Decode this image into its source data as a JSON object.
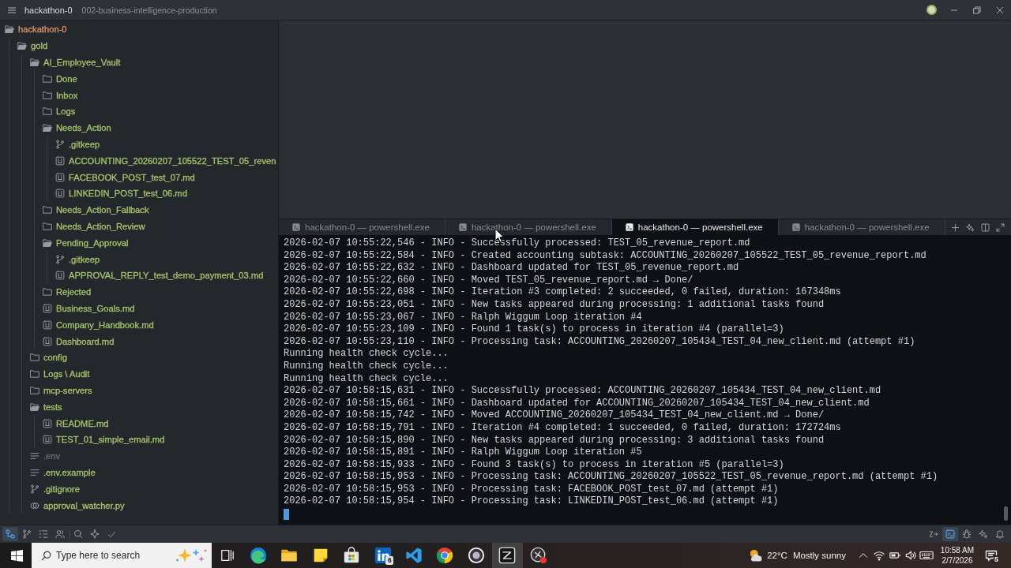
{
  "title_bar": {
    "project": "hackathon-0",
    "branch": "002-business-intelligence-production"
  },
  "sidebar": {
    "tree": [
      {
        "name": "hackathon-0",
        "kind": "folder",
        "expanded": true,
        "color": "#d9966b",
        "children": [
          {
            "name": "gold",
            "kind": "folder",
            "expanded": true,
            "color": "#a6c46d",
            "children": [
              {
                "name": "AI_Employee_Vault",
                "kind": "folder",
                "expanded": true,
                "color": "#a6c46d",
                "children": [
                  {
                    "name": "Done",
                    "kind": "folder",
                    "expanded": false,
                    "color": "#a6c46d"
                  },
                  {
                    "name": "Inbox",
                    "kind": "folder",
                    "expanded": false,
                    "color": "#a6c46d"
                  },
                  {
                    "name": "Logs",
                    "kind": "folder",
                    "expanded": false,
                    "color": "#a6c46d"
                  },
                  {
                    "name": "Needs_Action",
                    "kind": "folder",
                    "expanded": true,
                    "color": "#a6c46d",
                    "children": [
                      {
                        "name": ".gitkeep",
                        "kind": "git",
                        "color": "#a6c46d"
                      },
                      {
                        "name": "ACCOUNTING_20260207_105522_TEST_05_reven",
                        "kind": "markdown",
                        "color": "#a6c46d"
                      },
                      {
                        "name": "FACEBOOK_POST_test_07.md",
                        "kind": "markdown",
                        "color": "#a6c46d"
                      },
                      {
                        "name": "LINKEDIN_POST_test_06.md",
                        "kind": "markdown",
                        "color": "#a6c46d"
                      }
                    ]
                  },
                  {
                    "name": "Needs_Action_Fallback",
                    "kind": "folder",
                    "expanded": false,
                    "color": "#a6c46d"
                  },
                  {
                    "name": "Needs_Action_Review",
                    "kind": "folder",
                    "expanded": false,
                    "color": "#a6c46d"
                  },
                  {
                    "name": "Pending_Approval",
                    "kind": "folder",
                    "expanded": true,
                    "color": "#a6c46d",
                    "children": [
                      {
                        "name": ".gitkeep",
                        "kind": "git",
                        "color": "#a6c46d"
                      },
                      {
                        "name": "APPROVAL_REPLY_test_demo_payment_03.md",
                        "kind": "markdown",
                        "color": "#a6c46d"
                      }
                    ]
                  },
                  {
                    "name": "Rejected",
                    "kind": "folder",
                    "expanded": false,
                    "color": "#a6c46d"
                  },
                  {
                    "name": "Business_Goals.md",
                    "kind": "markdown",
                    "color": "#a6c46d"
                  },
                  {
                    "name": "Company_Handbook.md",
                    "kind": "markdown",
                    "color": "#a6c46d"
                  },
                  {
                    "name": "Dashboard.md",
                    "kind": "markdown",
                    "color": "#a6c46d"
                  }
                ]
              },
              {
                "name": "config",
                "kind": "folder",
                "expanded": false,
                "color": "#a6c46d"
              },
              {
                "name": "Logs \\ Audit",
                "kind": "folder",
                "expanded": false,
                "color": "#a6c46d"
              },
              {
                "name": "mcp-servers",
                "kind": "folder",
                "expanded": false,
                "color": "#a6c46d"
              },
              {
                "name": "tests",
                "kind": "folder",
                "expanded": true,
                "color": "#a6c46d",
                "children": [
                  {
                    "name": "README.md",
                    "kind": "markdown",
                    "color": "#a6c46d"
                  },
                  {
                    "name": "TEST_01_simple_email.md",
                    "kind": "markdown",
                    "color": "#a6c46d"
                  }
                ]
              },
              {
                "name": ".env",
                "kind": "text",
                "color": "#6c7077"
              },
              {
                "name": ".env.example",
                "kind": "text",
                "color": "#a6c46d"
              },
              {
                "name": ".gitignore",
                "kind": "git",
                "color": "#a6c46d"
              },
              {
                "name": "approval_watcher.py",
                "kind": "python",
                "color": "#a6c46d"
              }
            ]
          }
        ]
      }
    ]
  },
  "terminal": {
    "tabs": [
      {
        "label": "hackathon-0 — powershell.exe",
        "selected": false
      },
      {
        "label": "hackathon-0 — powershell.exe",
        "selected": false
      },
      {
        "label": "hackathon-0 — powershell.exe",
        "selected": true
      },
      {
        "label": "hackathon-0 — powershell.exe",
        "selected": false
      }
    ],
    "lines": [
      "2026-02-07 10:55:22,546 - INFO - Successfully processed: TEST_05_revenue_report.md",
      "2026-02-07 10:55:22,584 - INFO - Created accounting subtask: ACCOUNTING_20260207_105522_TEST_05_revenue_report.md",
      "2026-02-07 10:55:22,632 - INFO - Dashboard updated for TEST_05_revenue_report.md",
      "2026-02-07 10:55:22,660 - INFO - Moved TEST_05_revenue_report.md → Done/",
      "2026-02-07 10:55:22,698 - INFO - Iteration #3 completed: 2 succeeded, 0 failed, duration: 167348ms",
      "2026-02-07 10:55:23,051 - INFO - New tasks appeared during processing: 1 additional tasks found",
      "2026-02-07 10:55:23,067 - INFO - Ralph Wiggum Loop iteration #4",
      "2026-02-07 10:55:23,109 - INFO - Found 1 task(s) to process in iteration #4 (parallel=3)",
      "2026-02-07 10:55:23,110 - INFO - Processing task: ACCOUNTING_20260207_105434_TEST_04_new_client.md (attempt #1)",
      "Running health check cycle...",
      "Running health check cycle...",
      "Running health check cycle...",
      "2026-02-07 10:58:15,631 - INFO - Successfully processed: ACCOUNTING_20260207_105434_TEST_04_new_client.md",
      "2026-02-07 10:58:15,661 - INFO - Dashboard updated for ACCOUNTING_20260207_105434_TEST_04_new_client.md",
      "2026-02-07 10:58:15,742 - INFO - Moved ACCOUNTING_20260207_105434_TEST_04_new_client.md → Done/",
      "2026-02-07 10:58:15,791 - INFO - Iteration #4 completed: 1 succeeded, 0 failed, duration: 172724ms",
      "2026-02-07 10:58:15,890 - INFO - New tasks appeared during processing: 3 additional tasks found",
      "2026-02-07 10:58:15,891 - INFO - Ralph Wiggum Loop iteration #5",
      "2026-02-07 10:58:15,933 - INFO - Found 3 task(s) to process in iteration #5 (parallel=3)",
      "2026-02-07 10:58:15,953 - INFO - Processing task: ACCOUNTING_20260207_105522_TEST_05_revenue_report.md (attempt #1)",
      "2026-02-07 10:58:15,953 - INFO - Processing task: FACEBOOK_POST_test_07.md (attempt #1)",
      "2026-02-07 10:58:15,954 - INFO - Processing task: LINKEDIN_POST_test_06.md (attempt #1)"
    ]
  },
  "status_bar": {
    "left_groups": [
      [
        {
          "kind": "project",
          "selected": true
        },
        {
          "kind": "git",
          "selected": false
        },
        {
          "kind": "outline",
          "selected": false
        },
        {
          "kind": "collab",
          "selected": false
        }
      ],
      [
        {
          "kind": "search",
          "selected": false
        },
        {
          "kind": "assistant",
          "selected": false
        },
        {
          "kind": "diagnostics",
          "selected": false
        }
      ]
    ],
    "right": [
      {
        "kind": "keymap",
        "selected": false
      },
      {
        "kind": "terminal",
        "selected": true
      },
      {
        "kind": "debug",
        "selected": false
      },
      {
        "kind": "ai",
        "selected": false
      },
      {
        "kind": "notifications",
        "selected": false
      }
    ]
  },
  "taskbar": {
    "search": {
      "placeholder": "Type here to search"
    },
    "apps": [
      {
        "kind": "task_view",
        "selected": false
      },
      {
        "kind": "edge",
        "selected": false
      },
      {
        "kind": "explorer",
        "selected": false
      },
      {
        "kind": "notes",
        "selected": false
      },
      {
        "kind": "store",
        "selected": false
      },
      {
        "kind": "linkedin",
        "selected": false,
        "badge": "6"
      },
      {
        "kind": "vscode",
        "selected": false
      },
      {
        "kind": "chrome",
        "selected": false
      },
      {
        "kind": "obs",
        "selected": false
      },
      {
        "kind": "zed",
        "selected": true
      },
      {
        "kind": "recorder",
        "selected": false
      }
    ],
    "weather": {
      "temperature": "22°C",
      "condition": "Mostly sunny"
    },
    "tray": [
      {
        "kind": "chevron"
      },
      {
        "kind": "network"
      },
      {
        "kind": "battery"
      },
      {
        "kind": "volume"
      },
      {
        "kind": "keyboard"
      }
    ],
    "clock": {
      "time": "10:58 AM",
      "date": "2/7/2026"
    },
    "notifications": {
      "count": "5"
    }
  }
}
